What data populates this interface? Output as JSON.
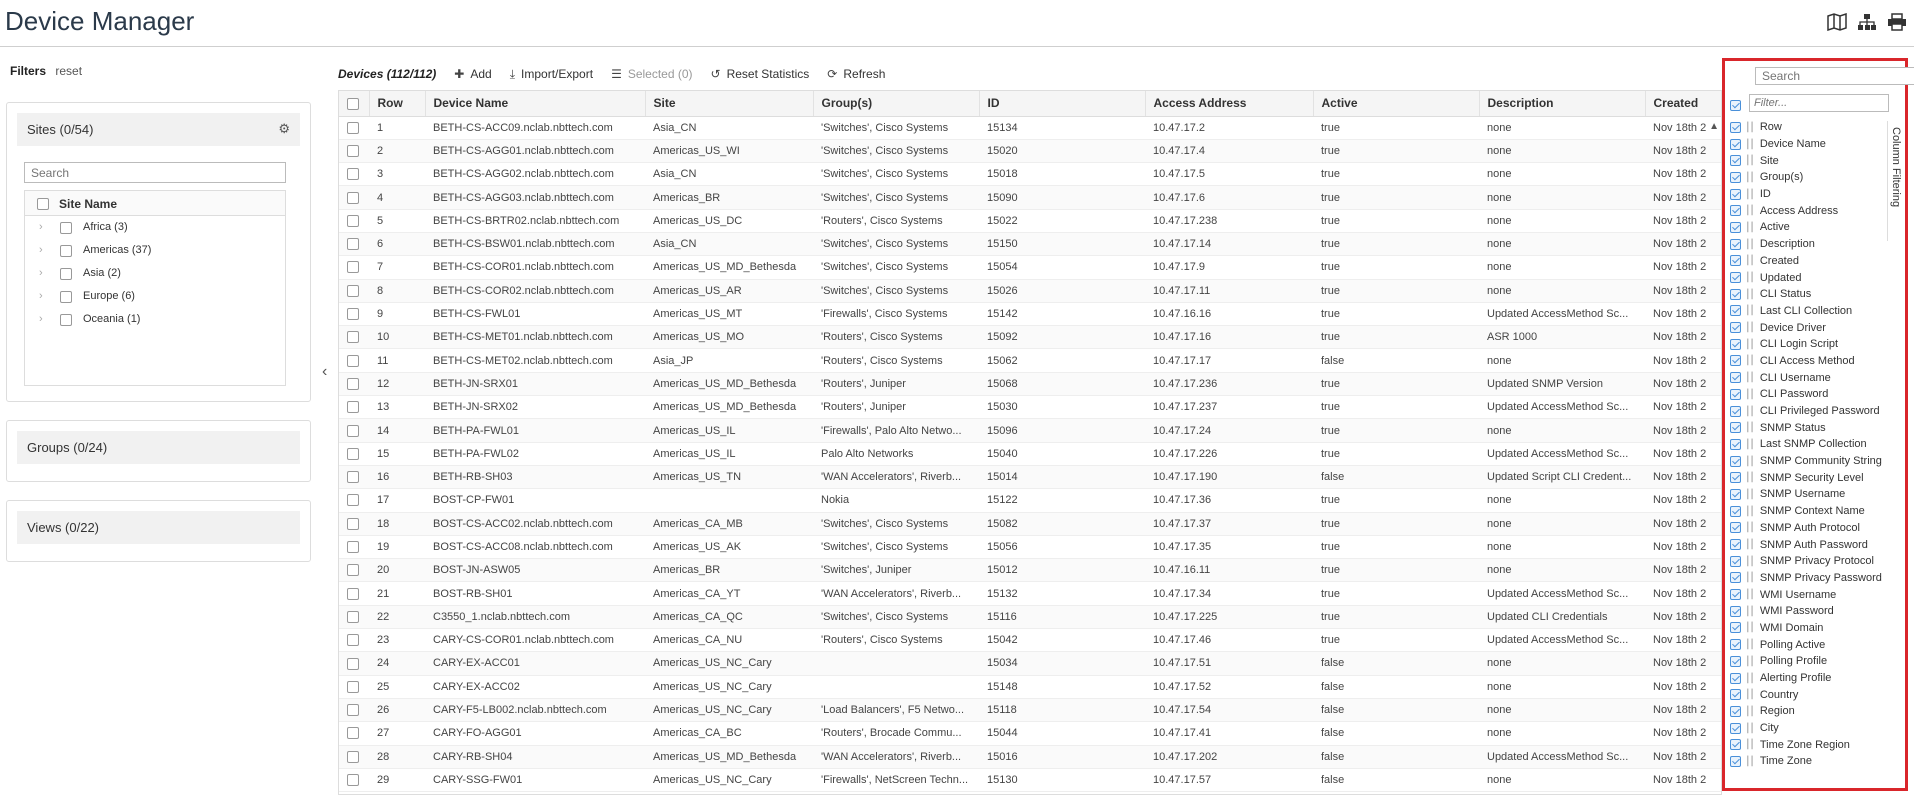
{
  "app": {
    "title": "Device Manager"
  },
  "top_icons": [
    "map-icon",
    "topology-icon",
    "print-icon"
  ],
  "filters": {
    "label": "Filters",
    "reset": "reset",
    "sites": {
      "title": "Sites (0/54)",
      "search_placeholder": "Search",
      "column": "Site Name",
      "items": [
        {
          "label": "Africa (3)"
        },
        {
          "label": "Americas (37)"
        },
        {
          "label": "Asia (2)"
        },
        {
          "label": "Europe (6)"
        },
        {
          "label": "Oceania (1)"
        }
      ]
    },
    "groups": {
      "title": "Groups (0/24)"
    },
    "views": {
      "title": "Views (0/22)"
    }
  },
  "toolbar": {
    "title": "Devices (112/112)",
    "add": "Add",
    "import_export": "Import/Export",
    "selected": "Selected (0)",
    "reset_statistics": "Reset Statistics",
    "refresh": "Refresh"
  },
  "grid": {
    "columns": [
      "Row",
      "Device Name",
      "Site",
      "Group(s)",
      "ID",
      "Access Address",
      "Active",
      "Description",
      "Created"
    ],
    "rows": [
      [
        "1",
        "BETH-CS-ACC09.nclab.nbttech.com",
        "Asia_CN",
        "'Switches', Cisco Systems",
        "15134",
        "10.47.17.2",
        "true",
        "none",
        "Nov 18th 2"
      ],
      [
        "2",
        "BETH-CS-AGG01.nclab.nbttech.com",
        "Americas_US_WI",
        "'Switches', Cisco Systems",
        "15020",
        "10.47.17.4",
        "true",
        "none",
        "Nov 18th 2"
      ],
      [
        "3",
        "BETH-CS-AGG02.nclab.nbttech.com",
        "Asia_CN",
        "'Switches', Cisco Systems",
        "15018",
        "10.47.17.5",
        "true",
        "none",
        "Nov 18th 2"
      ],
      [
        "4",
        "BETH-CS-AGG03.nclab.nbttech.com",
        "Americas_BR",
        "'Switches', Cisco Systems",
        "15090",
        "10.47.17.6",
        "true",
        "none",
        "Nov 18th 2"
      ],
      [
        "5",
        "BETH-CS-BRTR02.nclab.nbttech.com",
        "Americas_US_DC",
        "'Routers', Cisco Systems",
        "15022",
        "10.47.17.238",
        "true",
        "none",
        "Nov 18th 2"
      ],
      [
        "6",
        "BETH-CS-BSW01.nclab.nbttech.com",
        "Asia_CN",
        "'Switches', Cisco Systems",
        "15150",
        "10.47.17.14",
        "true",
        "none",
        "Nov 18th 2"
      ],
      [
        "7",
        "BETH-CS-COR01.nclab.nbttech.com",
        "Americas_US_MD_Bethesda",
        "'Switches', Cisco Systems",
        "15054",
        "10.47.17.9",
        "true",
        "none",
        "Nov 18th 2"
      ],
      [
        "8",
        "BETH-CS-COR02.nclab.nbttech.com",
        "Americas_US_AR",
        "'Switches', Cisco Systems",
        "15026",
        "10.47.17.11",
        "true",
        "none",
        "Nov 18th 2"
      ],
      [
        "9",
        "BETH-CS-FWL01",
        "Americas_US_MT",
        "'Firewalls', Cisco Systems",
        "15142",
        "10.47.16.16",
        "true",
        "Updated AccessMethod Sc...",
        "Nov 18th 2"
      ],
      [
        "10",
        "BETH-CS-MET01.nclab.nbttech.com",
        "Americas_US_MO",
        "'Routers', Cisco Systems",
        "15092",
        "10.47.17.16",
        "true",
        "ASR 1000",
        "Nov 18th 2"
      ],
      [
        "11",
        "BETH-CS-MET02.nclab.nbttech.com",
        "Asia_JP",
        "'Routers', Cisco Systems",
        "15062",
        "10.47.17.17",
        "false",
        "none",
        "Nov 18th 2"
      ],
      [
        "12",
        "BETH-JN-SRX01",
        "Americas_US_MD_Bethesda",
        "'Routers', Juniper",
        "15068",
        "10.47.17.236",
        "true",
        "Updated SNMP Version",
        "Nov 18th 2"
      ],
      [
        "13",
        "BETH-JN-SRX02",
        "Americas_US_MD_Bethesda",
        "'Routers', Juniper",
        "15030",
        "10.47.17.237",
        "true",
        "Updated AccessMethod Sc...",
        "Nov 18th 2"
      ],
      [
        "14",
        "BETH-PA-FWL01",
        "Americas_US_IL",
        "'Firewalls', Palo Alto Netwo...",
        "15096",
        "10.47.17.24",
        "true",
        "none",
        "Nov 18th 2"
      ],
      [
        "15",
        "BETH-PA-FWL02",
        "Americas_US_IL",
        "Palo Alto Networks",
        "15040",
        "10.47.17.226",
        "true",
        "Updated AccessMethod Sc...",
        "Nov 18th 2"
      ],
      [
        "16",
        "BETH-RB-SH03",
        "Americas_US_TN",
        "'WAN Accelerators', Riverb...",
        "15014",
        "10.47.17.190",
        "false",
        "Updated Script CLI Credent...",
        "Nov 18th 2"
      ],
      [
        "17",
        "BOST-CP-FW01",
        "",
        "Nokia",
        "15122",
        "10.47.17.36",
        "true",
        "none",
        "Nov 18th 2"
      ],
      [
        "18",
        "BOST-CS-ACC02.nclab.nbttech.com",
        "Americas_CA_MB",
        "'Switches', Cisco Systems",
        "15082",
        "10.47.17.37",
        "true",
        "none",
        "Nov 18th 2"
      ],
      [
        "19",
        "BOST-CS-ACC08.nclab.nbttech.com",
        "Americas_US_AK",
        "'Switches', Cisco Systems",
        "15056",
        "10.47.17.35",
        "true",
        "none",
        "Nov 18th 2"
      ],
      [
        "20",
        "BOST-JN-ASW05",
        "Americas_BR",
        "'Switches', Juniper",
        "15012",
        "10.47.16.11",
        "true",
        "none",
        "Nov 18th 2"
      ],
      [
        "21",
        "BOST-RB-SH01",
        "Americas_CA_YT",
        "'WAN Accelerators', Riverb...",
        "15132",
        "10.47.17.34",
        "true",
        "Updated AccessMethod Sc...",
        "Nov 18th 2"
      ],
      [
        "22",
        "C3550_1.nclab.nbttech.com",
        "Americas_CA_QC",
        "'Switches', Cisco Systems",
        "15116",
        "10.47.17.225",
        "true",
        "Updated CLI Credentials",
        "Nov 18th 2"
      ],
      [
        "23",
        "CARY-CS-COR01.nclab.nbttech.com",
        "Americas_CA_NU",
        "'Routers', Cisco Systems",
        "15042",
        "10.47.17.46",
        "true",
        "Updated AccessMethod Sc...",
        "Nov 18th 2"
      ],
      [
        "24",
        "CARY-EX-ACC01",
        "Americas_US_NC_Cary",
        "",
        "15034",
        "10.47.17.51",
        "false",
        "none",
        "Nov 18th 2"
      ],
      [
        "25",
        "CARY-EX-ACC02",
        "Americas_US_NC_Cary",
        "",
        "15148",
        "10.47.17.52",
        "false",
        "none",
        "Nov 18th 2"
      ],
      [
        "26",
        "CARY-F5-LB002.nclab.nbttech.com",
        "Americas_US_NC_Cary",
        "'Load Balancers', F5 Netwo...",
        "15118",
        "10.47.17.54",
        "false",
        "none",
        "Nov 18th 2"
      ],
      [
        "27",
        "CARY-FO-AGG01",
        "Americas_CA_BC",
        "'Routers', Brocade Commu...",
        "15044",
        "10.47.17.41",
        "false",
        "none",
        "Nov 18th 2"
      ],
      [
        "28",
        "CARY-RB-SH04",
        "Americas_US_MD_Bethesda",
        "'WAN Accelerators', Riverb...",
        "15016",
        "10.47.17.202",
        "false",
        "Updated AccessMethod Sc...",
        "Nov 18th 2"
      ],
      [
        "29",
        "CARY-SSG-FW01",
        "Americas_US_NC_Cary",
        "'Firewalls', NetScreen Techn...",
        "15130",
        "10.47.17.57",
        "false",
        "none",
        "Nov 18th 2"
      ]
    ]
  },
  "column_panel": {
    "search_placeholder": "Search",
    "filter_placeholder": "Filter...",
    "tab_label": "Column Filtering",
    "columns": [
      "Row",
      "Device Name",
      "Site",
      "Group(s)",
      "ID",
      "Access Address",
      "Active",
      "Description",
      "Created",
      "Updated",
      "CLI Status",
      "Last CLI Collection",
      "Device Driver",
      "CLI Login Script",
      "CLI Access Method",
      "CLI Username",
      "CLI Password",
      "CLI Privileged Password",
      "SNMP Status",
      "Last SNMP Collection",
      "SNMP Community String",
      "SNMP Security Level",
      "SNMP Username",
      "SNMP Context Name",
      "SNMP Auth Protocol",
      "SNMP Auth Password",
      "SNMP Privacy Protocol",
      "SNMP Privacy Password",
      "WMI Username",
      "WMI Password",
      "WMI Domain",
      "Polling Active",
      "Polling Profile",
      "Alerting Profile",
      "Country",
      "Region",
      "City",
      "Time Zone Region",
      "Time Zone"
    ]
  },
  "colors": {
    "highlight": "#d9262b",
    "checkbox_accent": "#4a90d9"
  }
}
